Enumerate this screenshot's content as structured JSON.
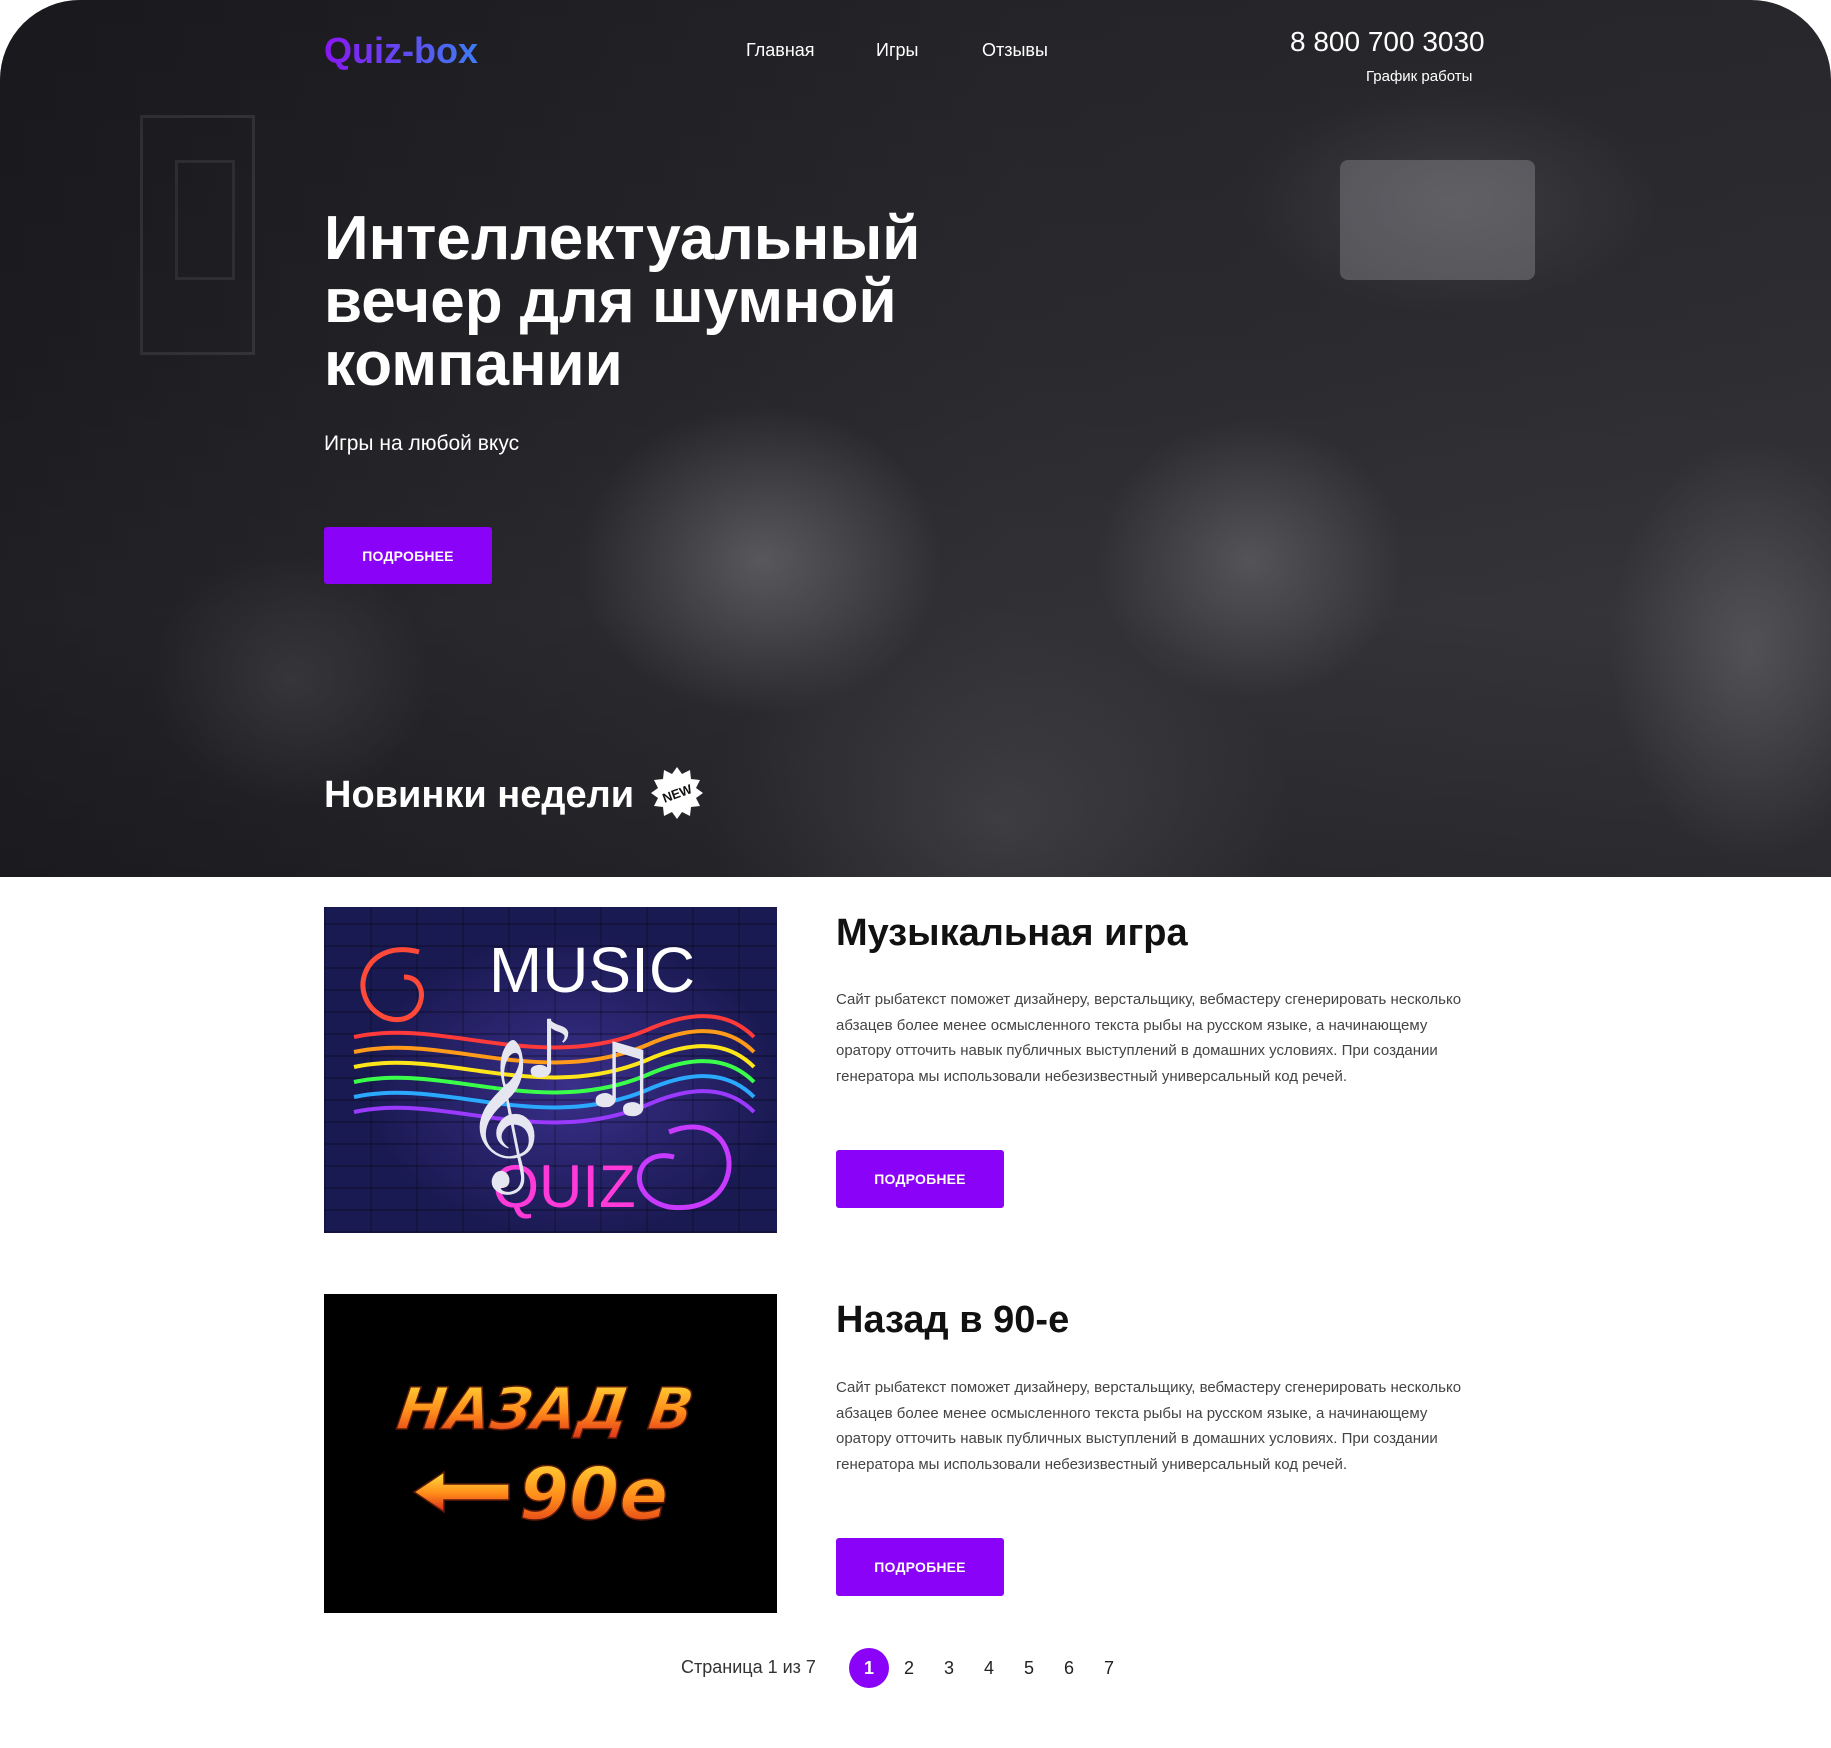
{
  "header": {
    "logo": "Quiz-box",
    "nav": [
      {
        "label": "Главная"
      },
      {
        "label": "Игры"
      },
      {
        "label": "Отзывы"
      }
    ],
    "phone": "8 800 700 3030",
    "schedule_label": "График работы"
  },
  "hero": {
    "title": "Интеллектуальный вечер для шумной компании",
    "subtitle": "Игры на любой вкус",
    "button_label": "ПОДРОБНЕЕ"
  },
  "news": {
    "title": "Новинки недели",
    "badge": "NEW"
  },
  "games": [
    {
      "title": "Музыкальная игра",
      "text": "Сайт рыбатекст поможет дизайнеру, верстальщику, вебмастеру сгенерировать несколько абзацев более менее осмысленного текста рыбы на русском языке, а начинающему оратору отточить навык публичных выступлений в домашних условиях. При создании генератора мы использовали небезизвестный универсальный код речей.",
      "button_label": "ПОДРОБНЕЕ",
      "image_text_top": "MUSIC",
      "image_text_bottom": "QUIZ"
    },
    {
      "title": "Назад в 90-е",
      "text": "Сайт рыбатекст поможет дизайнеру, верстальщику, вебмастеру сгенерировать несколько абзацев более менее осмысленного текста рыбы на русском языке, а начинающему оратору отточить навык публичных выступлений в домашних условиях. При создании генератора мы использовали небезизвестный универсальный код речей.",
      "button_label": "ПОДРОБНЕЕ",
      "image_text_top": "НАЗАД В",
      "image_text_bottom": "90е"
    }
  ],
  "pagination": {
    "label": "Страница 1 из 7",
    "pages": [
      "1",
      "2",
      "3",
      "4",
      "5",
      "6",
      "7"
    ],
    "current": "1"
  },
  "colors": {
    "accent": "#8a02f7",
    "logo_gradient_start": "#8a16f2",
    "logo_gradient_end": "#3d7cf2"
  }
}
